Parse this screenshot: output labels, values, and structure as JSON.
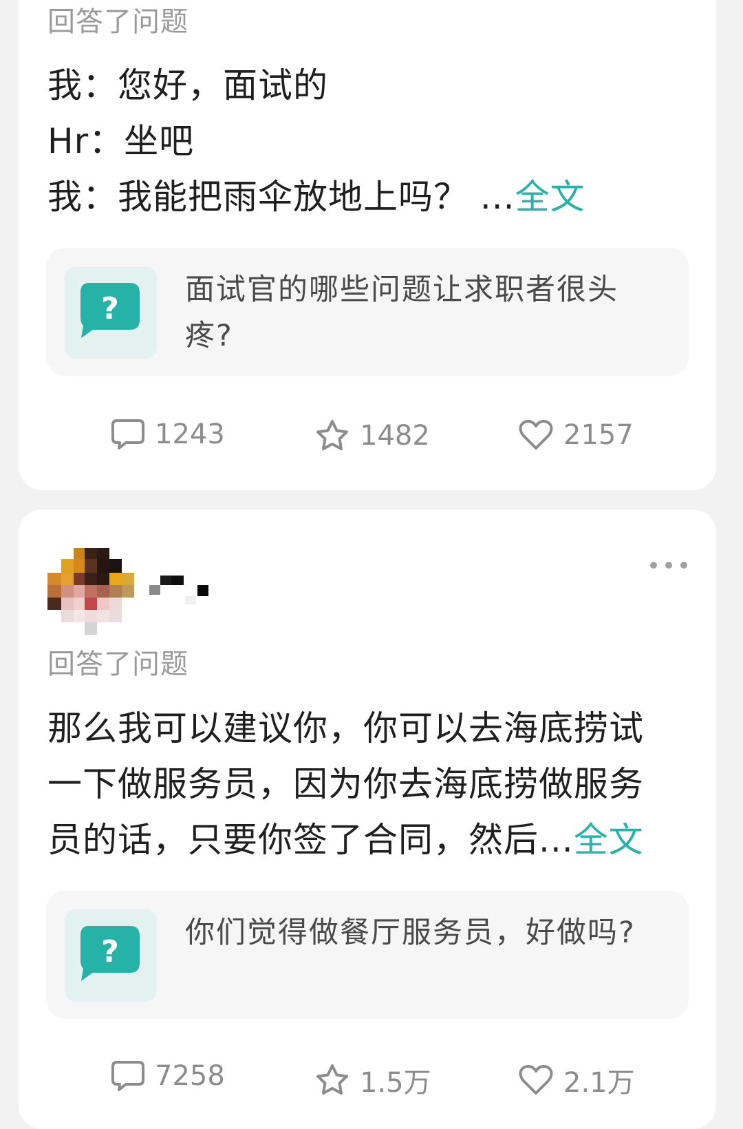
{
  "feed": [
    {
      "action_text": "回答了问题",
      "excerpt_lines": [
        "我：您好，面试的",
        "Hr：坐吧"
      ],
      "excerpt_last_line": "我：我能把雨伞放地上吗？ ...",
      "full_text_link": "全文",
      "question": {
        "icon": "question-bubble-icon",
        "title": "面试官的哪些问题让求职者很头疼?"
      },
      "stats": {
        "comments": "1243",
        "favorites": "1482",
        "likes": "2157"
      }
    },
    {
      "author": {
        "avatar": "avatar-pixelated",
        "name_blurred": true
      },
      "more_icon": "more-dots-icon",
      "action_text": "回答了问题",
      "excerpt_lines": [
        "那么我可以建议你，你可以去海底捞试",
        "一下做服务员，因为你去海底捞做服务"
      ],
      "excerpt_last_line": "员的话，只要你签了合同，然后...",
      "full_text_link": "全文",
      "question": {
        "icon": "question-bubble-icon",
        "title": "你们觉得做餐厅服务员，好做吗?"
      },
      "stats": {
        "comments": "7258",
        "favorites": "1.5万",
        "likes": "2.1万"
      }
    }
  ],
  "colors": {
    "accent": "#27b2a8",
    "background": "#f2f2f3",
    "card": "#ffffff",
    "question_box": "#f6f6f6",
    "muted_text": "#9a9a9a",
    "body_text": "#1f1f1f"
  }
}
